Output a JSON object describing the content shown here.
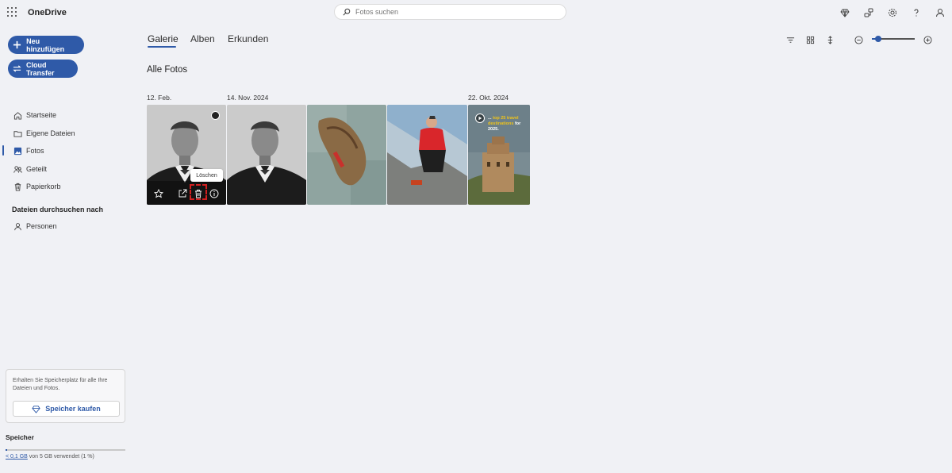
{
  "app": {
    "title": "OneDrive"
  },
  "search": {
    "placeholder": "Fotos suchen"
  },
  "left": {
    "new_button": "Neu hinzufügen",
    "transfer_button": "Cloud Transfer",
    "nav": [
      {
        "label": "Startseite",
        "icon": "home-icon"
      },
      {
        "label": "Eigene Dateien",
        "icon": "folder-icon"
      },
      {
        "label": "Fotos",
        "icon": "photo-icon",
        "active": true
      },
      {
        "label": "Geteilt",
        "icon": "people-icon"
      },
      {
        "label": "Papierkorb",
        "icon": "trash-icon"
      }
    ],
    "browse_title": "Dateien durchsuchen nach",
    "browse_items": [
      {
        "label": "Personen",
        "icon": "person-icon"
      }
    ],
    "promo_text": "Erhalten Sie Speicherplatz für alle Ihre Dateien und Fotos.",
    "buy_button": "Speicher kaufen",
    "storage_title": "Speicher",
    "storage_used": "< 0,1 GB",
    "storage_rest": " von 5 GB verwendet (1 %)",
    "storage_fraction": 0.01
  },
  "main": {
    "tabs": [
      "Galerie",
      "Alben",
      "Erkunden"
    ],
    "active_tab": "Galerie",
    "section_title": "Alle Fotos",
    "dates": [
      "12. Feb.",
      "14. Nov. 2024",
      "22. Okt. 2024"
    ],
    "tooltip": "Löschen",
    "video_caption": {
      "pre": "...",
      "highlight": "top 25 travel destinations",
      "post": "for 2025."
    }
  },
  "colors": {
    "accent": "#2f5aa8",
    "background": "#f0f1f5",
    "highlight": "#d21f1f"
  }
}
